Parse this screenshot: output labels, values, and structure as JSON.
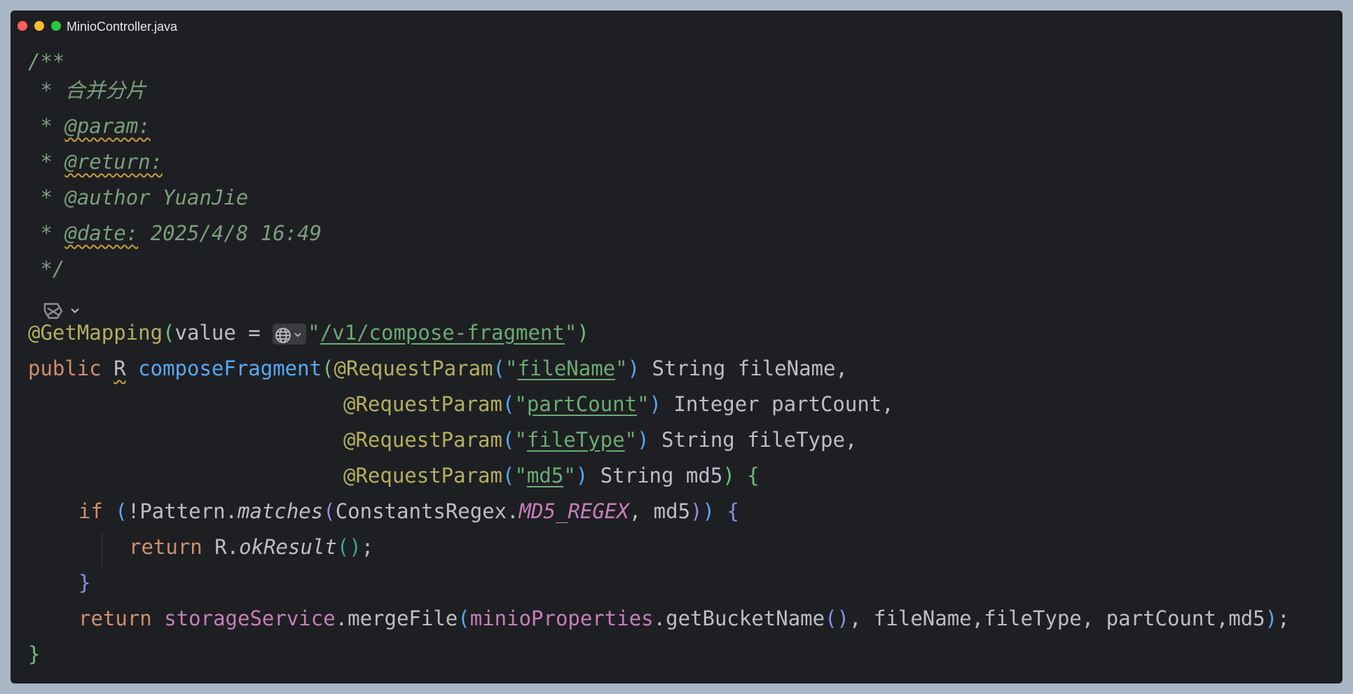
{
  "window": {
    "title": "MinioController.java"
  },
  "code": {
    "doc": {
      "open": "/**",
      "line1_prefix": " * ",
      "line1_text": "合并分片",
      "param_tag": "@param:",
      "return_tag": "@return:",
      "author_tag": "@author",
      "author_value": " YuanJie",
      "date_tag": "@date:",
      "date_value": " 2025/4/8 16:49",
      "close": " */"
    },
    "annotation": {
      "name": "@GetMapping",
      "attr": "value = ",
      "path": "/v1/compose-fragment"
    },
    "signature": {
      "public": "public",
      "type_r": "R",
      "method": "composeFragment",
      "request_param": "@RequestParam",
      "p1_key": "fileName",
      "p1_type": " String fileName,",
      "p2_key": "partCount",
      "p2_type": " Integer partCount,",
      "p3_key": "fileType",
      "p3_type": " String fileType,",
      "p4_key": "md5",
      "p4_type": " String md5"
    },
    "body": {
      "if_kw": "if",
      "pattern": "!Pattern.",
      "matches": "matches",
      "regex_class": "ConstantsRegex.",
      "regex_const": "MD5_REGEX",
      "md5_arg": ", md5",
      "return_kw": "return",
      "ok_obj": " R.",
      "ok_method": "okResult",
      "storage": "storageService",
      "merge": ".mergeFile",
      "minio": "minioProperties",
      "bucket": ".getBucketName",
      "merge_args": ", fileName,fileType, partCount,md5"
    }
  }
}
